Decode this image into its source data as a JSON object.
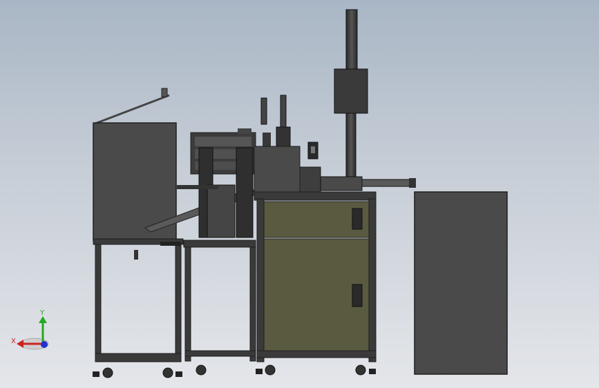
{
  "viewport": {
    "background_top": "#a9b6c5",
    "background_bottom": "#e4e6ea"
  },
  "triad": {
    "x_label": "X",
    "y_label": "Y",
    "x_color": "#cc2222",
    "y_color": "#22aa22",
    "z_color": "#2233cc"
  },
  "machine": {
    "frame_color": "#3a3a3a",
    "panel_color": "#4a4a4a",
    "cabinet_door_color": "#5a5a40",
    "edge_color": "#1e1e1e"
  }
}
